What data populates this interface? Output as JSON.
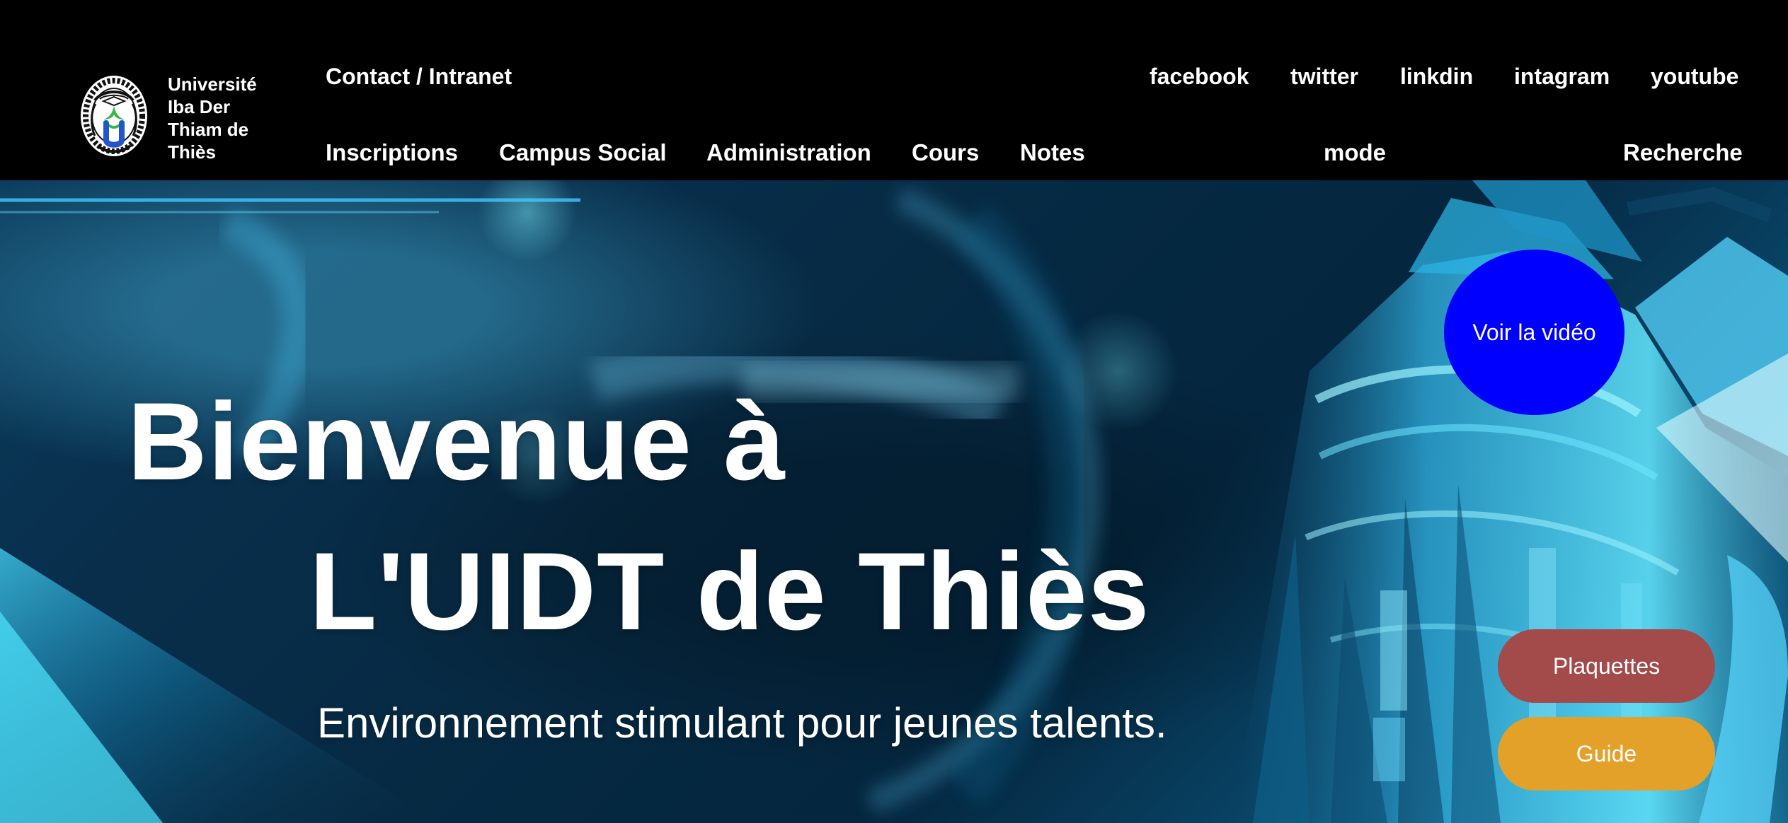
{
  "header": {
    "university_name": "Université\nIba Der\nThiam de\nThiès",
    "top_nav": {
      "contact": "Contact / Intranet",
      "social": [
        "facebook",
        "twitter",
        "linkdin",
        "intagram",
        "youtube"
      ]
    },
    "main_nav": [
      "Inscriptions",
      "Campus Social",
      "Administration",
      "Cours",
      "Notes",
      "mode",
      "Recherche"
    ]
  },
  "hero": {
    "title_line_1": "Bienvenue à",
    "title_line_2": "L'UIDT de Thiès",
    "subtitle": "Environnement stimulant pour jeunes talents.",
    "video_button": "Voir la vidéo",
    "plaquettes_button": "Plaquettes",
    "guide_button": "Guide"
  },
  "colors": {
    "header_background": "#000000",
    "text": "#ffffff",
    "video_button": "#0000ff",
    "plaquettes_button": "#a34a4a",
    "guide_button": "#e3a12a",
    "hero_blue": "#0a3150",
    "hero_cyan": "#42d1ff"
  },
  "icons": {
    "logo": "university-seal-logo"
  }
}
